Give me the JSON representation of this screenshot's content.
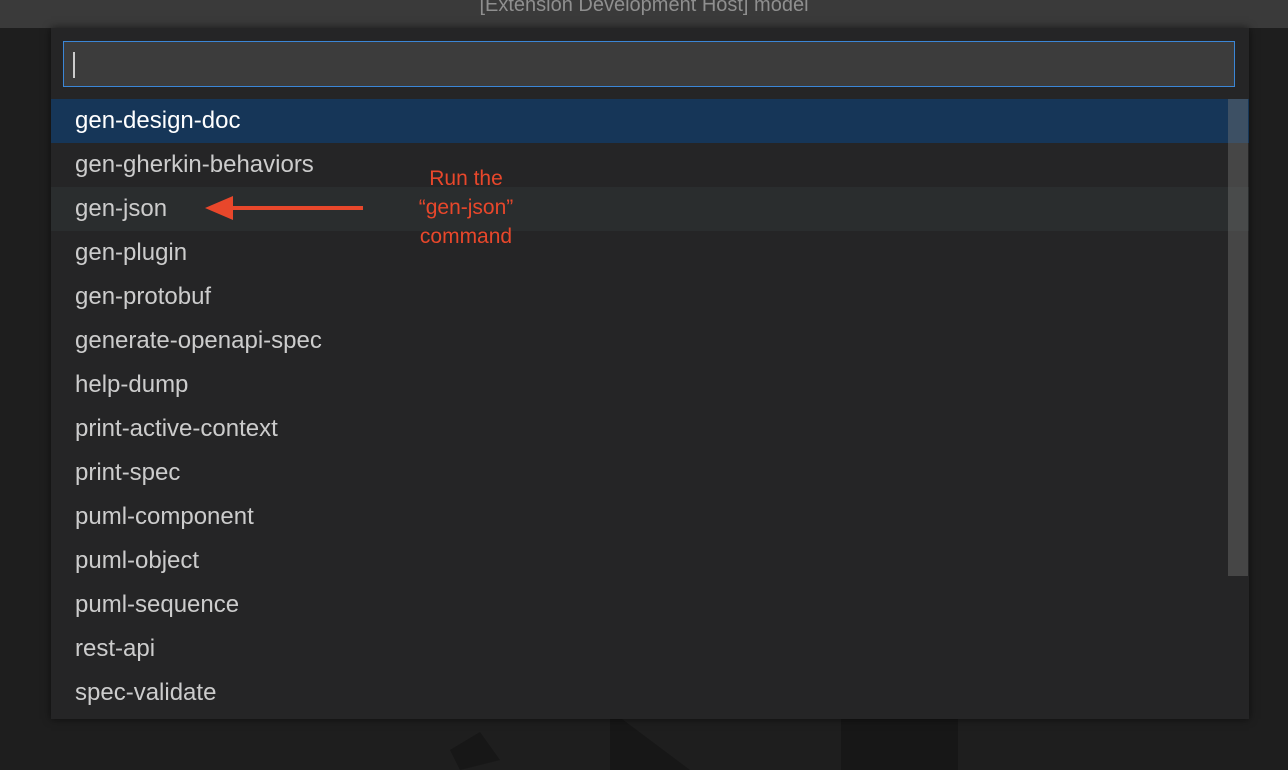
{
  "window": {
    "title": "[Extension Development Host] model"
  },
  "quick_pick": {
    "input_value": "",
    "items": [
      {
        "label": "gen-design-doc",
        "state": "selected"
      },
      {
        "label": "gen-gherkin-behaviors",
        "state": "normal"
      },
      {
        "label": "gen-json",
        "state": "hover"
      },
      {
        "label": "gen-plugin",
        "state": "normal"
      },
      {
        "label": "gen-protobuf",
        "state": "normal"
      },
      {
        "label": "generate-openapi-spec",
        "state": "normal"
      },
      {
        "label": "help-dump",
        "state": "normal"
      },
      {
        "label": "print-active-context",
        "state": "normal"
      },
      {
        "label": "print-spec",
        "state": "normal"
      },
      {
        "label": "puml-component",
        "state": "normal"
      },
      {
        "label": "puml-object",
        "state": "normal"
      },
      {
        "label": "puml-sequence",
        "state": "normal"
      },
      {
        "label": "rest-api",
        "state": "normal"
      },
      {
        "label": "spec-validate",
        "state": "normal"
      }
    ]
  },
  "annotation": {
    "lines": [
      "Run the",
      "“gen-json”",
      "command"
    ],
    "color": "#e8472b",
    "arrow_icon": "arrow-left-icon"
  },
  "colors": {
    "selected_bg": "#163658",
    "focus_border": "#3b86d6",
    "panel_bg": "#252526"
  }
}
